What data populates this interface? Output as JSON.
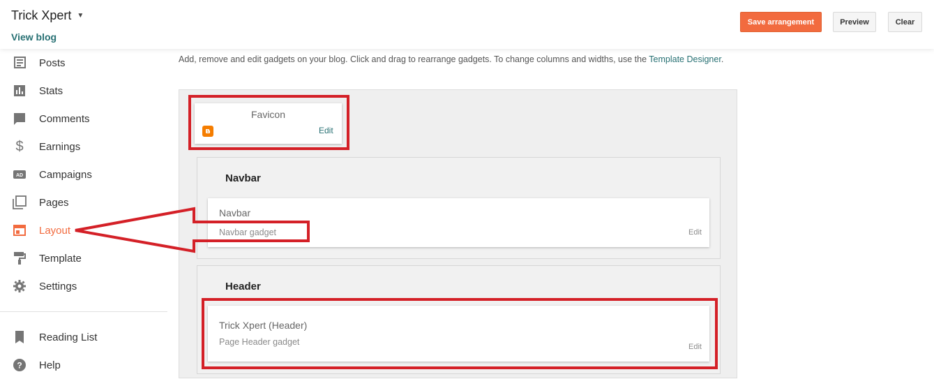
{
  "header": {
    "blog_title": "Trick Xpert",
    "view_blog": "View blog",
    "save_label": "Save arrangement",
    "preview_label": "Preview",
    "clear_label": "Clear"
  },
  "sidebar": {
    "items": [
      {
        "label": "Posts",
        "icon": "posts-icon"
      },
      {
        "label": "Stats",
        "icon": "stats-icon"
      },
      {
        "label": "Comments",
        "icon": "comments-icon"
      },
      {
        "label": "Earnings",
        "icon": "dollar-icon"
      },
      {
        "label": "Campaigns",
        "icon": "ad-icon"
      },
      {
        "label": "Pages",
        "icon": "pages-icon"
      },
      {
        "label": "Layout",
        "icon": "layout-icon",
        "active": true
      },
      {
        "label": "Template",
        "icon": "paint-roller-icon"
      },
      {
        "label": "Settings",
        "icon": "gear-icon"
      }
    ],
    "bottom_items": [
      {
        "label": "Reading List",
        "icon": "bookmark-icon"
      },
      {
        "label": "Help",
        "icon": "help-icon"
      }
    ]
  },
  "main": {
    "description": "Add, remove and edit gadgets on your blog. Click and drag to rearrange gadgets. To change columns and widths, use the",
    "description_link": "Template Designer",
    "description_end": ".",
    "favicon": {
      "title": "Favicon",
      "edit": "Edit"
    },
    "navbar_section": {
      "title": "Navbar",
      "gadget": {
        "title": "Navbar",
        "subtitle": "Navbar gadget",
        "edit": "Edit"
      }
    },
    "header_section": {
      "title": "Header",
      "gadget": {
        "title": "Trick Xpert (Header)",
        "subtitle": "Page Header gadget",
        "edit": "Edit"
      }
    }
  },
  "colors": {
    "accent": "#f26b3f",
    "link": "#277073",
    "annotation_red": "#d42027"
  }
}
